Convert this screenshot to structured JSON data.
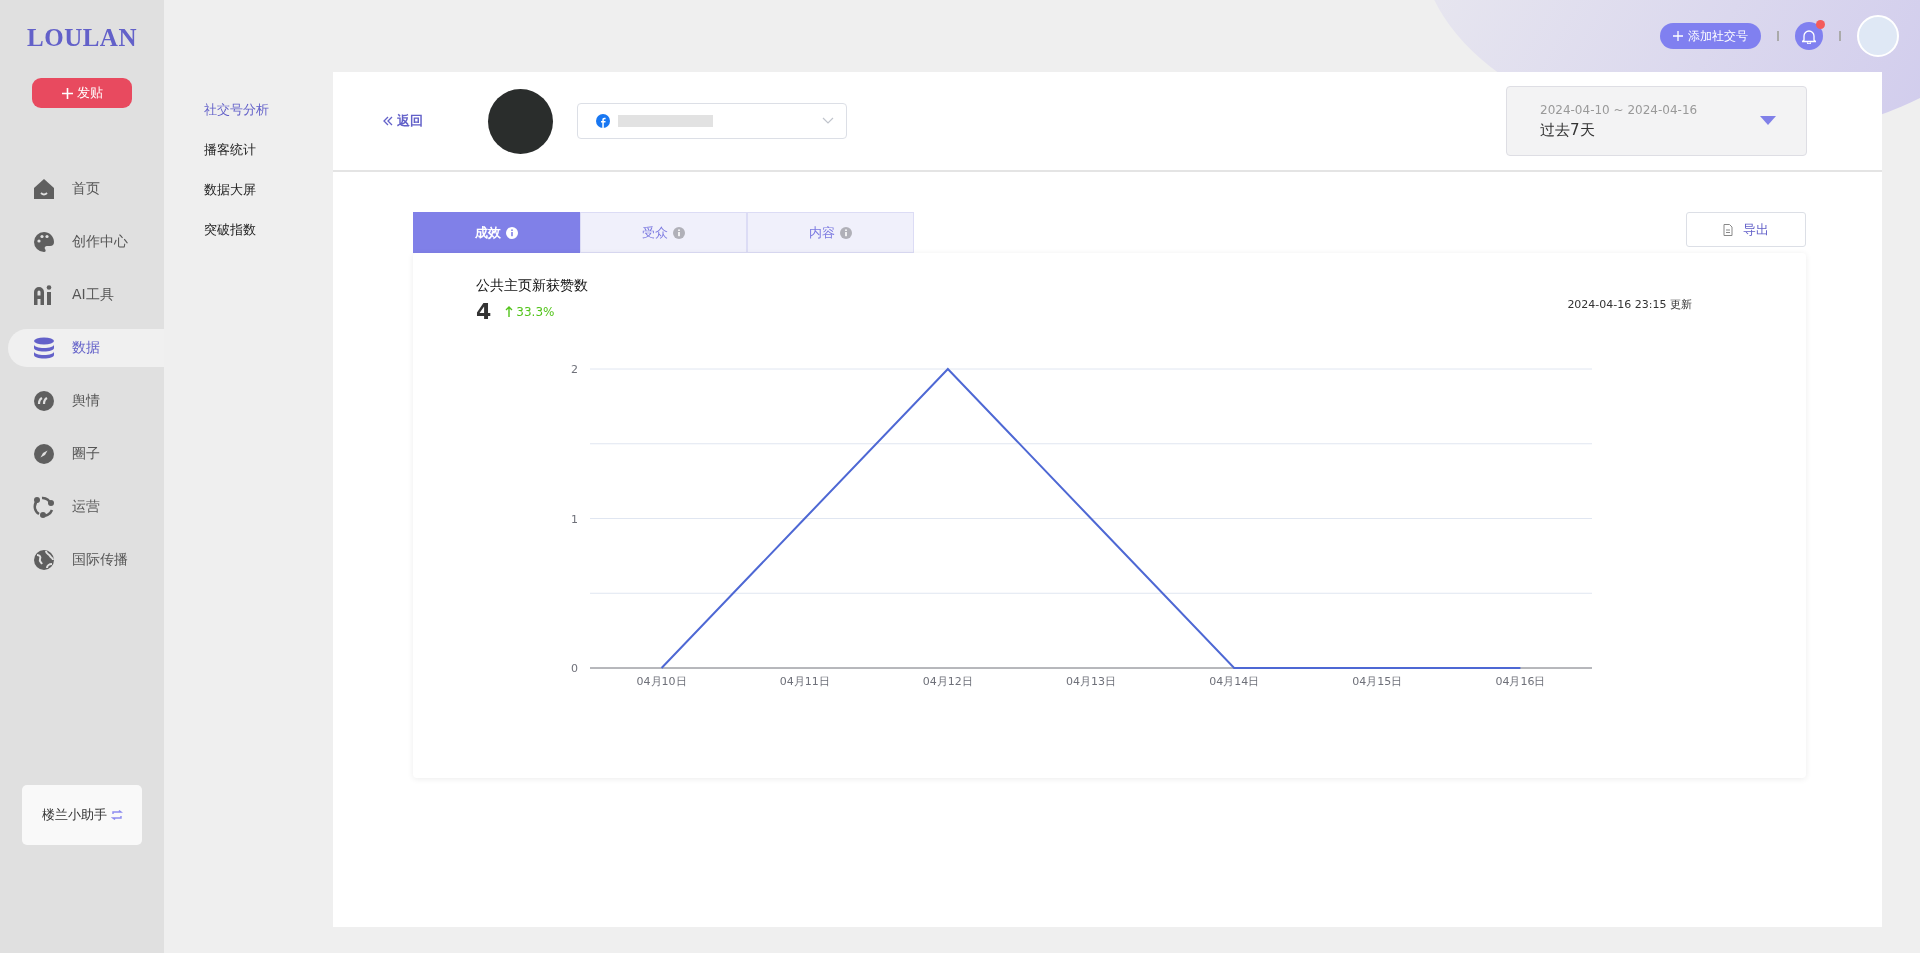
{
  "logo": "LOULAN",
  "post_button": "发贴",
  "sidebar": {
    "items": [
      {
        "label": "首页",
        "selected": false
      },
      {
        "label": "创作中心",
        "selected": false
      },
      {
        "label": "AI工具",
        "selected": false
      },
      {
        "label": "数据",
        "selected": true
      },
      {
        "label": "舆情",
        "selected": false
      },
      {
        "label": "圈子",
        "selected": false
      },
      {
        "label": "运营",
        "selected": false
      },
      {
        "label": "国际传播",
        "selected": false
      }
    ]
  },
  "assistant": "楼兰小助手",
  "subnav": {
    "items": [
      {
        "label": "社交号分析",
        "selected": true
      },
      {
        "label": "播客统计",
        "selected": false
      },
      {
        "label": "数据大屏",
        "selected": false
      },
      {
        "label": "突破指数",
        "selected": false
      }
    ]
  },
  "top_bar": {
    "add_account_button": "添加社交号",
    "notifications": {
      "unread": true
    }
  },
  "header": {
    "back_link": "返回",
    "date_range": {
      "range": "2024-04-10 ~ 2024-04-16",
      "label": "过去7天"
    }
  },
  "tabs": [
    {
      "label": "成效",
      "selected": true
    },
    {
      "label": "受众",
      "selected": false
    },
    {
      "label": "内容",
      "selected": false
    }
  ],
  "export_button": "导出",
  "metric": {
    "title": "公共主页新获赞数",
    "value": "4",
    "change": "33.3%",
    "updated": "2024-04-16 23:15 更新",
    "chart_data": {
      "type": "line",
      "categories": [
        "04月10日",
        "04月11日",
        "04月12日",
        "04月13日",
        "04月14日",
        "04月15日",
        "04月16日"
      ],
      "series": [
        {
          "color": "#4e68d4",
          "values": [
            0,
            1,
            2,
            1,
            0,
            0,
            0
          ]
        }
      ],
      "ylim": [
        0,
        2
      ],
      "yticks": [
        0,
        1,
        2
      ]
    }
  }
}
